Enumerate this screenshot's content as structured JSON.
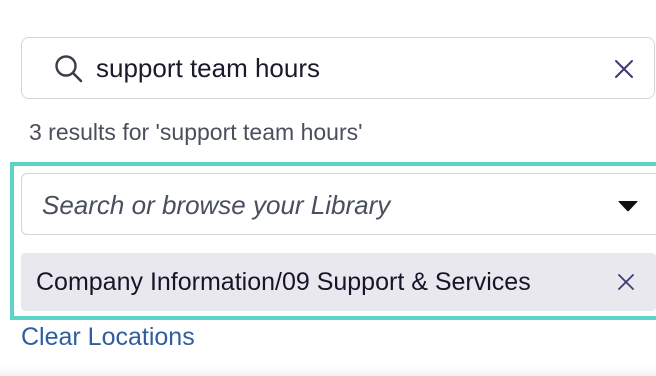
{
  "search": {
    "query": "support team hours",
    "search_icon": "search-icon",
    "clear_icon": "close-icon"
  },
  "results": {
    "summary": "3 results for 'support team hours'"
  },
  "library": {
    "placeholder": "Search or browse your Library",
    "caret_icon": "caret-down-icon"
  },
  "locations": {
    "selected": [
      {
        "label": "Company Information/09 Support & Services",
        "remove_icon": "close-icon"
      }
    ],
    "clear_label": "Clear Locations"
  },
  "colors": {
    "highlight": "#5fd3c8",
    "chip_bg": "#e9e8ef",
    "link": "#2d5fa0",
    "icon": "#3b3b7a"
  }
}
